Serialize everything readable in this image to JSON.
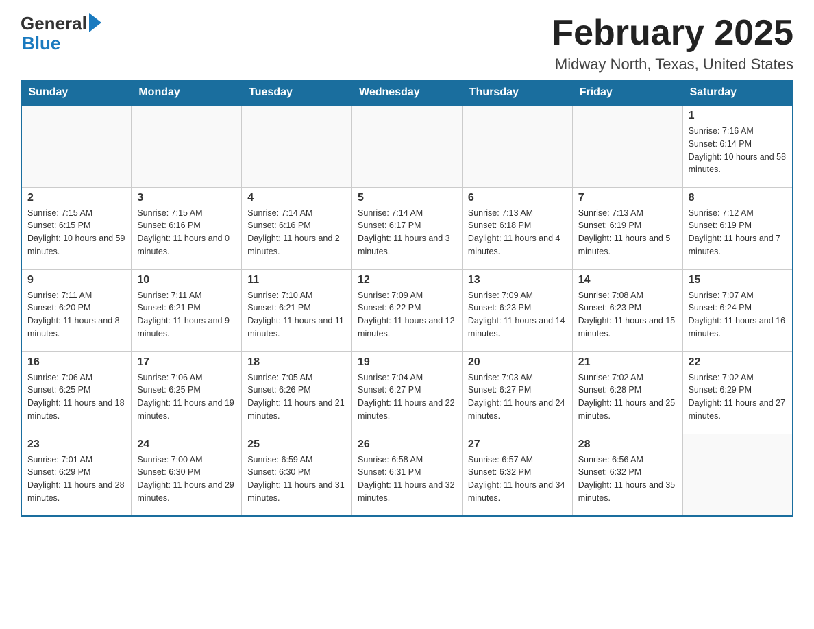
{
  "header": {
    "logo_general": "General",
    "logo_blue": "Blue",
    "title": "February 2025",
    "subtitle": "Midway North, Texas, United States"
  },
  "days_of_week": [
    "Sunday",
    "Monday",
    "Tuesday",
    "Wednesday",
    "Thursday",
    "Friday",
    "Saturday"
  ],
  "weeks": [
    [
      {
        "day": null
      },
      {
        "day": null
      },
      {
        "day": null
      },
      {
        "day": null
      },
      {
        "day": null
      },
      {
        "day": null
      },
      {
        "day": 1,
        "sunrise": "7:16 AM",
        "sunset": "6:14 PM",
        "daylight": "10 hours and 58 minutes."
      }
    ],
    [
      {
        "day": 2,
        "sunrise": "7:15 AM",
        "sunset": "6:15 PM",
        "daylight": "10 hours and 59 minutes."
      },
      {
        "day": 3,
        "sunrise": "7:15 AM",
        "sunset": "6:16 PM",
        "daylight": "11 hours and 0 minutes."
      },
      {
        "day": 4,
        "sunrise": "7:14 AM",
        "sunset": "6:16 PM",
        "daylight": "11 hours and 2 minutes."
      },
      {
        "day": 5,
        "sunrise": "7:14 AM",
        "sunset": "6:17 PM",
        "daylight": "11 hours and 3 minutes."
      },
      {
        "day": 6,
        "sunrise": "7:13 AM",
        "sunset": "6:18 PM",
        "daylight": "11 hours and 4 minutes."
      },
      {
        "day": 7,
        "sunrise": "7:13 AM",
        "sunset": "6:19 PM",
        "daylight": "11 hours and 5 minutes."
      },
      {
        "day": 8,
        "sunrise": "7:12 AM",
        "sunset": "6:19 PM",
        "daylight": "11 hours and 7 minutes."
      }
    ],
    [
      {
        "day": 9,
        "sunrise": "7:11 AM",
        "sunset": "6:20 PM",
        "daylight": "11 hours and 8 minutes."
      },
      {
        "day": 10,
        "sunrise": "7:11 AM",
        "sunset": "6:21 PM",
        "daylight": "11 hours and 9 minutes."
      },
      {
        "day": 11,
        "sunrise": "7:10 AM",
        "sunset": "6:21 PM",
        "daylight": "11 hours and 11 minutes."
      },
      {
        "day": 12,
        "sunrise": "7:09 AM",
        "sunset": "6:22 PM",
        "daylight": "11 hours and 12 minutes."
      },
      {
        "day": 13,
        "sunrise": "7:09 AM",
        "sunset": "6:23 PM",
        "daylight": "11 hours and 14 minutes."
      },
      {
        "day": 14,
        "sunrise": "7:08 AM",
        "sunset": "6:23 PM",
        "daylight": "11 hours and 15 minutes."
      },
      {
        "day": 15,
        "sunrise": "7:07 AM",
        "sunset": "6:24 PM",
        "daylight": "11 hours and 16 minutes."
      }
    ],
    [
      {
        "day": 16,
        "sunrise": "7:06 AM",
        "sunset": "6:25 PM",
        "daylight": "11 hours and 18 minutes."
      },
      {
        "day": 17,
        "sunrise": "7:06 AM",
        "sunset": "6:25 PM",
        "daylight": "11 hours and 19 minutes."
      },
      {
        "day": 18,
        "sunrise": "7:05 AM",
        "sunset": "6:26 PM",
        "daylight": "11 hours and 21 minutes."
      },
      {
        "day": 19,
        "sunrise": "7:04 AM",
        "sunset": "6:27 PM",
        "daylight": "11 hours and 22 minutes."
      },
      {
        "day": 20,
        "sunrise": "7:03 AM",
        "sunset": "6:27 PM",
        "daylight": "11 hours and 24 minutes."
      },
      {
        "day": 21,
        "sunrise": "7:02 AM",
        "sunset": "6:28 PM",
        "daylight": "11 hours and 25 minutes."
      },
      {
        "day": 22,
        "sunrise": "7:02 AM",
        "sunset": "6:29 PM",
        "daylight": "11 hours and 27 minutes."
      }
    ],
    [
      {
        "day": 23,
        "sunrise": "7:01 AM",
        "sunset": "6:29 PM",
        "daylight": "11 hours and 28 minutes."
      },
      {
        "day": 24,
        "sunrise": "7:00 AM",
        "sunset": "6:30 PM",
        "daylight": "11 hours and 29 minutes."
      },
      {
        "day": 25,
        "sunrise": "6:59 AM",
        "sunset": "6:30 PM",
        "daylight": "11 hours and 31 minutes."
      },
      {
        "day": 26,
        "sunrise": "6:58 AM",
        "sunset": "6:31 PM",
        "daylight": "11 hours and 32 minutes."
      },
      {
        "day": 27,
        "sunrise": "6:57 AM",
        "sunset": "6:32 PM",
        "daylight": "11 hours and 34 minutes."
      },
      {
        "day": 28,
        "sunrise": "6:56 AM",
        "sunset": "6:32 PM",
        "daylight": "11 hours and 35 minutes."
      },
      {
        "day": null
      }
    ]
  ],
  "labels": {
    "sunrise": "Sunrise:",
    "sunset": "Sunset:",
    "daylight": "Daylight:"
  }
}
